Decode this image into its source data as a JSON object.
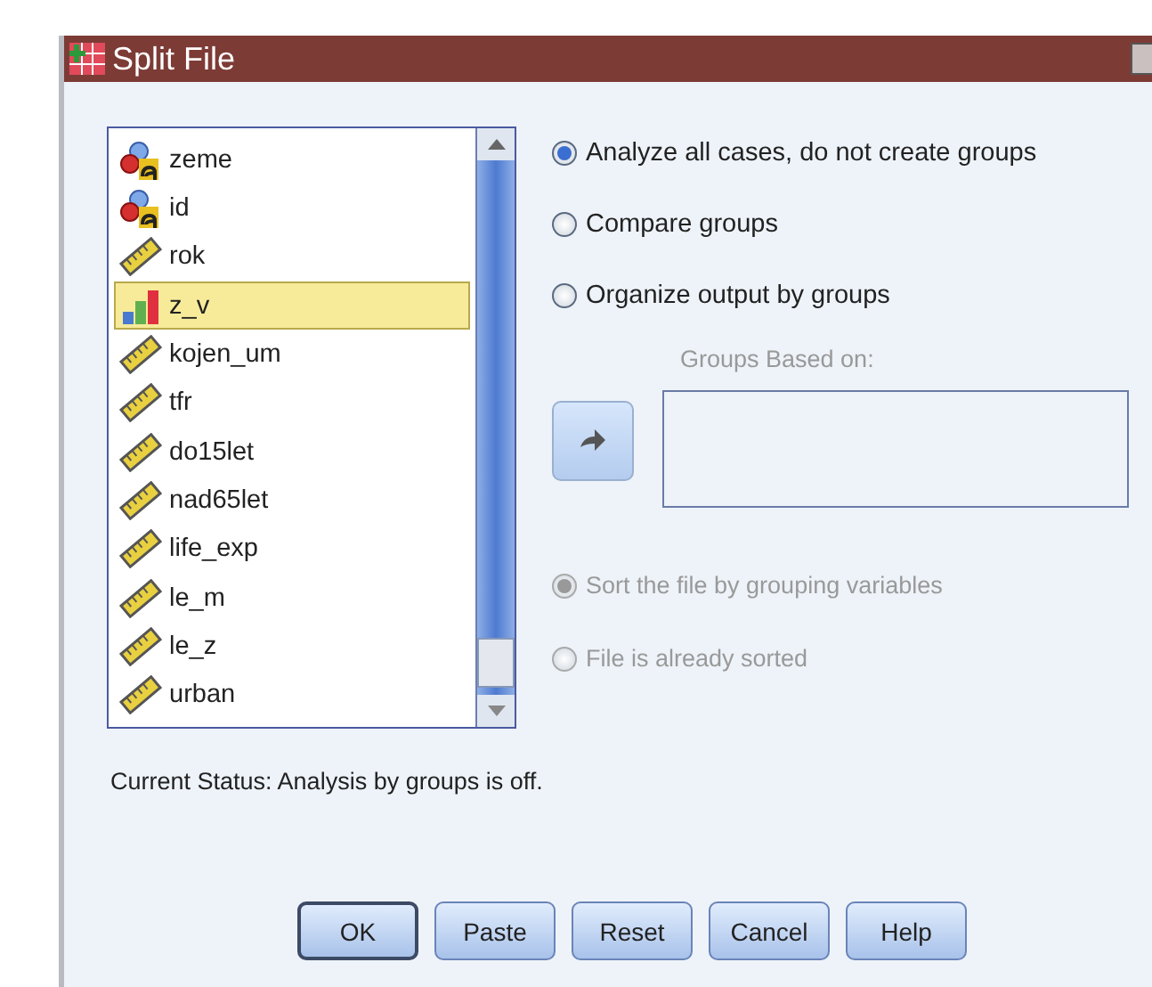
{
  "window": {
    "title": "Split File"
  },
  "variables": [
    {
      "name": "zeme",
      "kind": "nominal",
      "selected": false
    },
    {
      "name": "id",
      "kind": "nominal",
      "selected": false
    },
    {
      "name": "rok",
      "kind": "scale",
      "selected": false
    },
    {
      "name": "z_v",
      "kind": "ordinal",
      "selected": true
    },
    {
      "name": "kojen_um",
      "kind": "scale",
      "selected": false
    },
    {
      "name": "tfr",
      "kind": "scale",
      "selected": false
    },
    {
      "name": "do15let",
      "kind": "scale",
      "selected": false
    },
    {
      "name": "nad65let",
      "kind": "scale",
      "selected": false
    },
    {
      "name": "life_exp",
      "kind": "scale",
      "selected": false
    },
    {
      "name": "le_m",
      "kind": "scale",
      "selected": false
    },
    {
      "name": "le_z",
      "kind": "scale",
      "selected": false
    },
    {
      "name": "urban",
      "kind": "scale",
      "selected": false
    }
  ],
  "mode_options": [
    {
      "label": "Analyze all cases, do not create groups",
      "selected": true
    },
    {
      "label": "Compare groups",
      "selected": false
    },
    {
      "label": "Organize output by groups",
      "selected": false
    }
  ],
  "groups_based_on": {
    "label": "Groups Based on:",
    "disabled": true
  },
  "sort_options": [
    {
      "label": "Sort the file by grouping variables",
      "selected": true,
      "disabled": true
    },
    {
      "label": "File is already sorted",
      "selected": false,
      "disabled": true
    }
  ],
  "status": "Current Status: Analysis by groups is off.",
  "buttons": [
    {
      "label": "OK",
      "default": true
    },
    {
      "label": "Paste",
      "default": false
    },
    {
      "label": "Reset",
      "default": false
    },
    {
      "label": "Cancel",
      "default": false
    },
    {
      "label": "Help",
      "default": false
    }
  ]
}
